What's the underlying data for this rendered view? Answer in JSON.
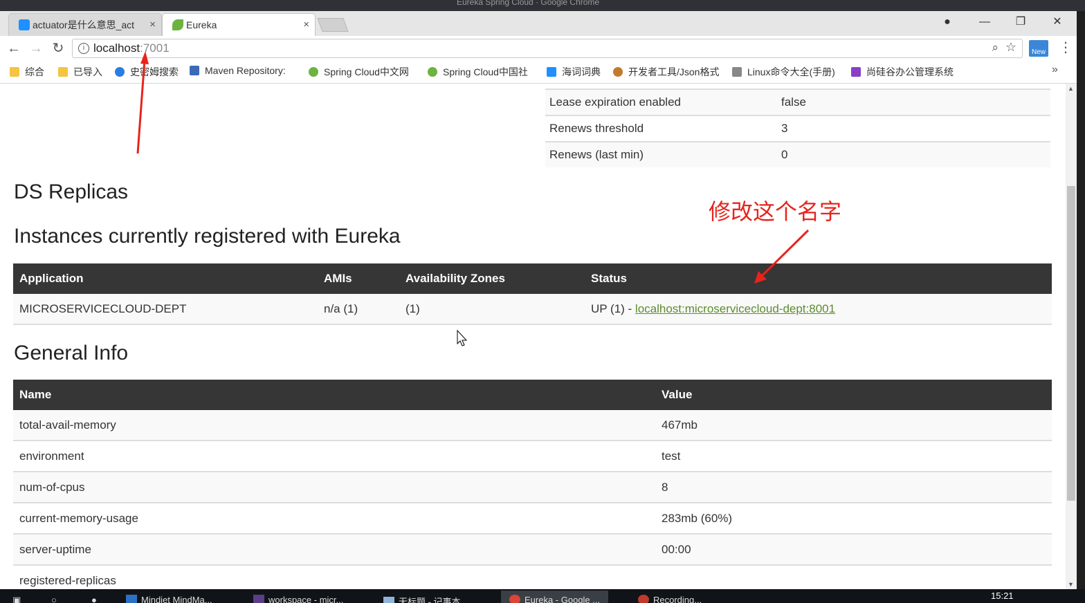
{
  "window": {
    "title": "Eureka Spring Cloud · Google Chrome"
  },
  "tabs": [
    {
      "label": "actuator是什么意思_act",
      "close": "×"
    },
    {
      "label": "Eureka",
      "close": "×"
    }
  ],
  "address": {
    "host": "localhost",
    "port": ":7001"
  },
  "bookmarks": [
    "综合",
    "已导入",
    "史密姆搜索",
    "Maven Repository:",
    "Spring Cloud中文网",
    "Spring Cloud中国社",
    "海词词典",
    "开发者工具/Json格式",
    "Linux命令大全(手册)",
    "尚硅谷办公管理系统"
  ],
  "lease": {
    "rows": [
      {
        "name": "Lease expiration enabled",
        "value": "false"
      },
      {
        "name": "Renews threshold",
        "value": "3"
      },
      {
        "name": "Renews (last min)",
        "value": "0"
      }
    ]
  },
  "ds_replicas": {
    "title": "DS Replicas"
  },
  "instances": {
    "title": "Instances currently registered with Eureka",
    "headers": [
      "Application",
      "AMIs",
      "Availability Zones",
      "Status"
    ],
    "row": {
      "application": "MICROSERVICECLOUD-DEPT",
      "amis_label": "n/a",
      "amis_count": "(1)",
      "zones": "(1)",
      "status_prefix": "UP (1) - ",
      "status_link": "localhost:microservicecloud-dept:8001"
    }
  },
  "annotation": {
    "text": "修改这个名字"
  },
  "general_info": {
    "title": "General Info",
    "headers": [
      "Name",
      "Value"
    ],
    "rows": [
      {
        "name": "total-avail-memory",
        "value": "467mb"
      },
      {
        "name": "environment",
        "value": "test"
      },
      {
        "name": "num-of-cpus",
        "value": "8"
      },
      {
        "name": "current-memory-usage",
        "value": "283mb (60%)"
      },
      {
        "name": "server-uptime",
        "value": "00:00"
      },
      {
        "name": "registered-replicas",
        "value": ""
      }
    ]
  },
  "taskbar": {
    "items": [
      "Mindjet MindMa...",
      "workspace - micr...",
      "无标题 - 记事本",
      "Eureka - Google ...",
      "Recording..."
    ],
    "clock": "15:21"
  },
  "colors": {
    "header_bg": "#363636",
    "link": "#5d8c2d",
    "annotation": "#e8231c"
  }
}
